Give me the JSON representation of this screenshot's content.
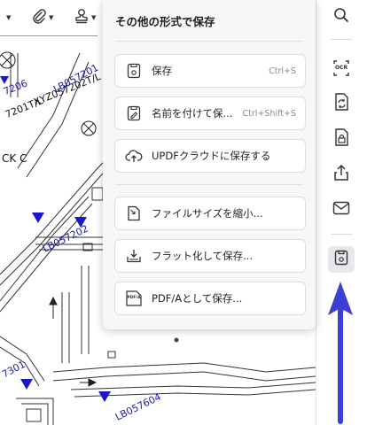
{
  "menu": {
    "title": "その他の形式で保存",
    "items": [
      {
        "label": "保存",
        "shortcut": "Ctrl+S",
        "icon": "save-icon"
      },
      {
        "label": "名前を付けて保...",
        "shortcut": "Ctrl+Shift+S",
        "icon": "save-as-icon"
      },
      {
        "label": "UPDFクラウドに保存する",
        "shortcut": "",
        "icon": "cloud-upload-icon"
      },
      {
        "label": "ファイルサイズを縮小...",
        "shortcut": "",
        "icon": "compress-icon"
      },
      {
        "label": "フラット化して保存...",
        "shortcut": "",
        "icon": "flatten-icon"
      },
      {
        "label": "PDF/Aとして保存...",
        "shortcut": "",
        "icon": "pdfa-icon"
      }
    ]
  },
  "toolbar": {
    "icons": [
      "paperclip-icon",
      "stamp-icon"
    ]
  },
  "sidebar": {
    "icons": [
      "search-icon",
      "ocr-icon",
      "convert-icon",
      "protect-icon",
      "share-icon",
      "mail-icon",
      "save-icon"
    ],
    "ocr_text": "OCR"
  },
  "pdfa_badge": "PDF/A",
  "plan": {
    "labels_blue": [
      "LB057201",
      "LB057202",
      "LB057604",
      "7206",
      "7301"
    ],
    "labels_black": [
      "XYZ057202T/L",
      "7201T/L",
      "CK C"
    ]
  },
  "colors": {
    "accent_arrow": "#3b3fd6",
    "plan_blue": "#1a1aa8",
    "menu_bg": "#f7f7f7"
  }
}
